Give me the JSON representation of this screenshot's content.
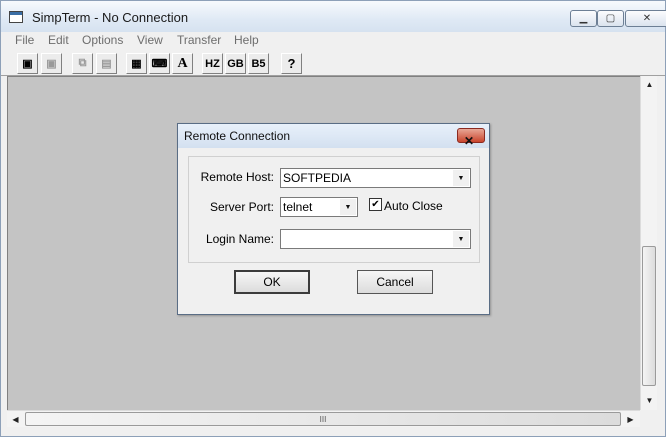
{
  "window": {
    "title": "SimpTerm - No Connection"
  },
  "menu": [
    "File",
    "Edit",
    "Options",
    "View",
    "Transfer",
    "Help"
  ],
  "toolbar": {
    "hz": "HZ",
    "gb": "GB",
    "b5": "B5",
    "font": "A",
    "help": "?"
  },
  "dialog": {
    "title": "Remote Connection",
    "close_glyph": "✕",
    "remote_host_label": "Remote Host:",
    "remote_host_value": "SOFTPEDIA",
    "server_port_label": "Server Port:",
    "server_port_value": "telnet",
    "auto_close_label": "Auto Close",
    "auto_close_checked": "✔",
    "login_name_label": "Login Name:",
    "login_name_value": "",
    "ok_label": "OK",
    "cancel_label": "Cancel"
  },
  "scrollbar": {
    "hscroll_grip": "III"
  }
}
